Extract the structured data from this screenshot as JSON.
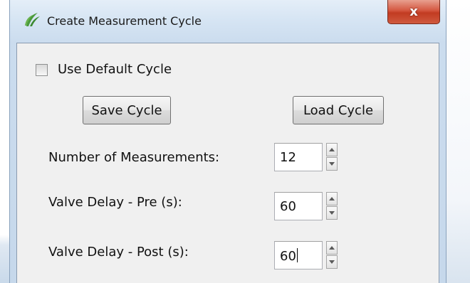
{
  "window": {
    "title": "Create Measurement Cycle",
    "close_symbol": "x",
    "icon": "leaf-logo-icon",
    "accent_close": "#c8452c"
  },
  "options": {
    "use_default_cycle_label": "Use Default Cycle",
    "use_default_cycle_checked": false
  },
  "buttons": {
    "save_label": "Save Cycle",
    "load_label": "Load Cycle"
  },
  "fields": [
    {
      "label": "Number of Measurements:",
      "value": "12"
    },
    {
      "label": "Valve Delay - Pre (s):",
      "value": "60"
    },
    {
      "label": "Valve Delay - Post (s):",
      "value": "60"
    }
  ]
}
